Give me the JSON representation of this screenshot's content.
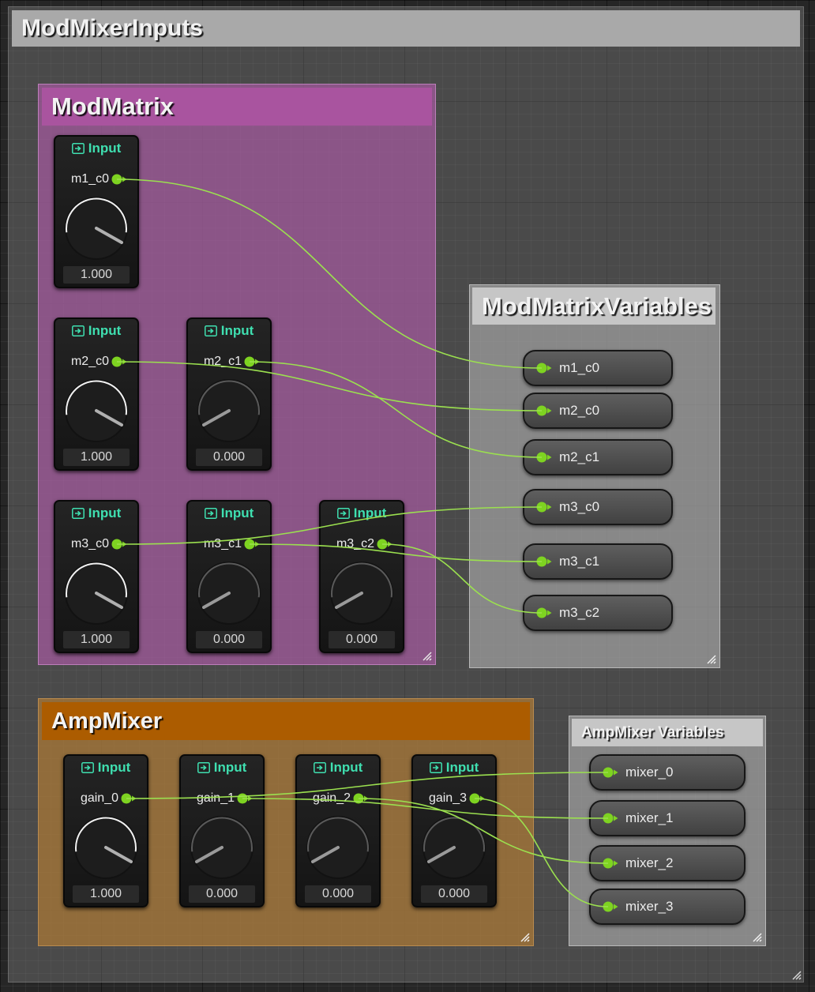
{
  "graph": {
    "title": "ModMixerInputs",
    "wire_color": "#9be04f",
    "pin_color": "#7ed321",
    "input_title_color": "#3fdfb0"
  },
  "groups": {
    "modmatrix": {
      "title": "ModMatrix",
      "color": "#a9549f"
    },
    "modmatrix_vars": {
      "title": "ModMatrixVariables",
      "color": "#c6c6c6"
    },
    "ampmixer": {
      "title": "AmpMixer",
      "color": "#ac5c00"
    },
    "ampmixer_vars": {
      "title": "AmpMixer Variables",
      "color": "#c6c6c6"
    }
  },
  "inputs": [
    {
      "id": "m1_c0",
      "title": "Input",
      "icon": "input-icon",
      "pin_label": "m1_c0",
      "value": "1.000"
    },
    {
      "id": "m2_c0",
      "title": "Input",
      "icon": "input-icon",
      "pin_label": "m2_c0",
      "value": "1.000"
    },
    {
      "id": "m2_c1",
      "title": "Input",
      "icon": "input-icon",
      "pin_label": "m2_c1",
      "value": "0.000"
    },
    {
      "id": "m3_c0",
      "title": "Input",
      "icon": "input-icon",
      "pin_label": "m3_c0",
      "value": "1.000"
    },
    {
      "id": "m3_c1",
      "title": "Input",
      "icon": "input-icon",
      "pin_label": "m3_c1",
      "value": "0.000"
    },
    {
      "id": "m3_c2",
      "title": "Input",
      "icon": "input-icon",
      "pin_label": "m3_c2",
      "value": "0.000"
    },
    {
      "id": "gain_0",
      "title": "Input",
      "icon": "input-icon",
      "pin_label": "gain_0",
      "value": "1.000"
    },
    {
      "id": "gain_1",
      "title": "Input",
      "icon": "input-icon",
      "pin_label": "gain_1",
      "value": "0.000"
    },
    {
      "id": "gain_2",
      "title": "Input",
      "icon": "input-icon",
      "pin_label": "gain_2",
      "value": "0.000"
    },
    {
      "id": "gain_3",
      "title": "Input",
      "icon": "input-icon",
      "pin_label": "gain_3",
      "value": "0.000"
    }
  ],
  "variables": [
    {
      "id": "m1_c0",
      "label": "m1_c0"
    },
    {
      "id": "m2_c0",
      "label": "m2_c0"
    },
    {
      "id": "m2_c1",
      "label": "m2_c1"
    },
    {
      "id": "m3_c0",
      "label": "m3_c0"
    },
    {
      "id": "m3_c1",
      "label": "m3_c1"
    },
    {
      "id": "m3_c2",
      "label": "m3_c2"
    },
    {
      "id": "mixer_0",
      "label": "mixer_0"
    },
    {
      "id": "mixer_1",
      "label": "mixer_1"
    },
    {
      "id": "mixer_2",
      "label": "mixer_2"
    },
    {
      "id": "mixer_3",
      "label": "mixer_3"
    }
  ],
  "connections": [
    {
      "from": "m1_c0",
      "to": "m1_c0"
    },
    {
      "from": "m2_c0",
      "to": "m2_c0"
    },
    {
      "from": "m2_c1",
      "to": "m2_c1"
    },
    {
      "from": "m3_c0",
      "to": "m3_c0"
    },
    {
      "from": "m3_c1",
      "to": "m3_c1"
    },
    {
      "from": "m3_c2",
      "to": "m3_c2"
    },
    {
      "from": "gain_0",
      "to": "mixer_0"
    },
    {
      "from": "gain_1",
      "to": "mixer_1"
    },
    {
      "from": "gain_2",
      "to": "mixer_2"
    },
    {
      "from": "gain_3",
      "to": "mixer_3"
    }
  ]
}
